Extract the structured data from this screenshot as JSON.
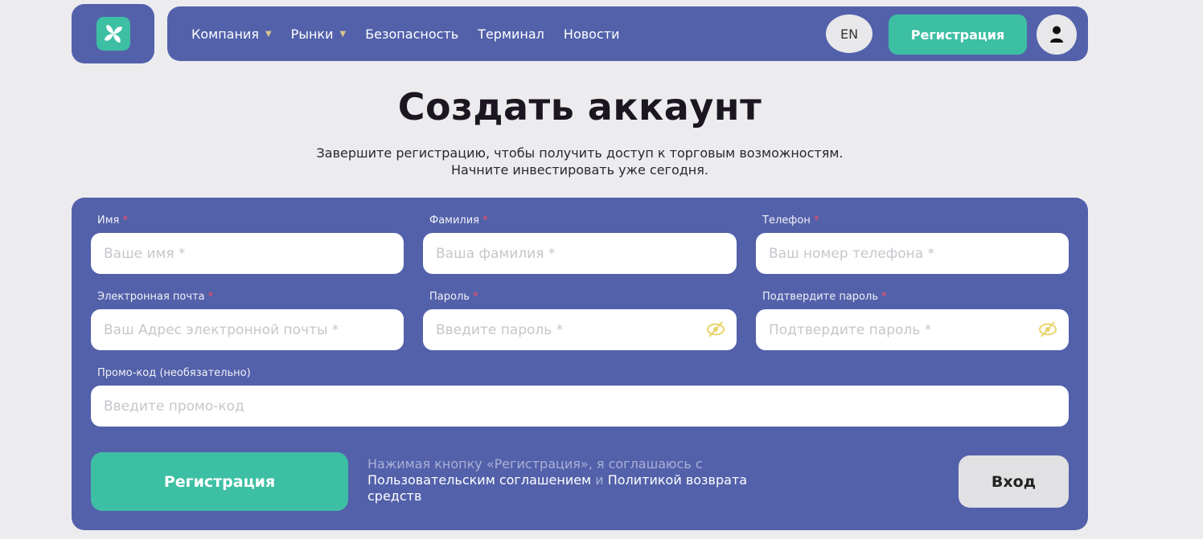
{
  "nav": {
    "items": [
      {
        "label": "Компания",
        "has_dropdown": true
      },
      {
        "label": "Рынки",
        "has_dropdown": true
      },
      {
        "label": "Безопасность",
        "has_dropdown": false
      },
      {
        "label": "Терминал",
        "has_dropdown": false
      },
      {
        "label": "Новости",
        "has_dropdown": false
      }
    ],
    "lang": "EN",
    "register_label": "Регистрация",
    "user_icon": "user-icon"
  },
  "page": {
    "title": "Создать аккаунт",
    "subtitle_line1": "Завершите регистрацию, чтобы получить доступ к торговым возможностям.",
    "subtitle_line2": "Начните инвестировать уже сегодня."
  },
  "form": {
    "first_name": {
      "label": "Имя",
      "placeholder": "Ваше имя *"
    },
    "last_name": {
      "label": "Фамилия",
      "placeholder": "Ваша фамилия *"
    },
    "phone": {
      "label": "Телефон",
      "placeholder": "Ваш номер телефона *"
    },
    "email": {
      "label": "Электронная почта",
      "placeholder": "Ваш Адрес электронной почты *"
    },
    "password": {
      "label": "Пароль",
      "placeholder": "Введите пароль *"
    },
    "confirm_password": {
      "label": "Подтвердите пароль",
      "placeholder": "Подтвердите пароль *"
    },
    "promo": {
      "label": "Промо-код (необязательно)",
      "placeholder": "Введите промо-код"
    },
    "required_mark": "*",
    "submit_label": "Регистрация",
    "consent_prefix": "Нажимая кнопку «Регистрация», я соглашаюсь с",
    "consent_link1": "Пользовательским соглашением",
    "consent_and": "и",
    "consent_link2": "Политикой возврата средств",
    "login_label": "Вход"
  },
  "colors": {
    "brand": "#5361ab",
    "accent": "#3dbfa3",
    "background": "#ececef",
    "required": "#ff4b5c"
  }
}
